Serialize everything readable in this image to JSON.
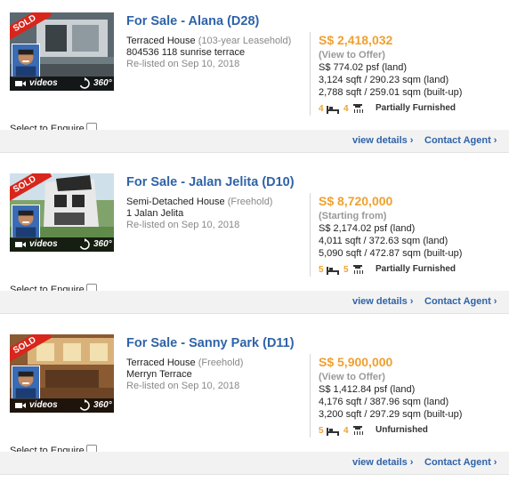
{
  "common": {
    "select_to_enquire": "Select to Enquire",
    "view_details": "view details ›",
    "contact_agent": "Contact Agent ›",
    "videos": "videos",
    "deg360": "360°",
    "sold": "SOLD"
  },
  "listings": [
    {
      "title": "For Sale - Alana (D28)",
      "type": "Terraced House",
      "tenure": "(103-year Leasehold)",
      "address": "804536 118 sunrise terrace",
      "relisted": "Re-listed on Sep 10, 2018",
      "price": "S$ 2,418,032",
      "price_note": "(View to Offer)",
      "psf": "S$ 774.02 psf (land)",
      "land": "3,124 sqft / 290.23 sqm (land)",
      "builtup": "2,788 sqft / 259.01 sqm (built-up)",
      "bedrooms": "4",
      "bathrooms": "4",
      "furnishing": "Partially Furnished",
      "photo_colors": [
        "#5b6870",
        "#c9cfd2",
        "#3b4246"
      ]
    },
    {
      "title": "For Sale - Jalan Jelita (D10)",
      "type": "Semi-Detached House",
      "tenure": "(Freehold)",
      "address": "1 Jalan Jelita",
      "relisted": "Re-listed on Sep 10, 2018",
      "price": "S$ 8,720,000",
      "price_note": "(Starting from)",
      "psf": "S$ 2,174.02 psf (land)",
      "land": "4,011 sqft / 372.63 sqm (land)",
      "builtup": "5,090 sqft / 472.87 sqm (built-up)",
      "bedrooms": "5",
      "bathrooms": "5",
      "furnishing": "Partially Furnished",
      "photo_colors": [
        "#7fa36a",
        "#e8e8e8",
        "#2a2a2a"
      ]
    },
    {
      "title": "For Sale - Sanny Park (D11)",
      "type": "Terraced House",
      "tenure": "(Freehold)",
      "address": "Merryn Terrace",
      "relisted": "Re-listed on Sep 10, 2018",
      "price": "S$ 5,900,000",
      "price_note": "(View to Offer)",
      "psf": "S$ 1,412.84 psf (land)",
      "land": "4,176 sqft / 387.96 sqm (land)",
      "builtup": "3,200 sqft / 297.29 sqm (built-up)",
      "bedrooms": "5",
      "bathrooms": "4",
      "furnishing": "Unfurnished",
      "photo_colors": [
        "#8a5a33",
        "#d9b27a",
        "#5a3820"
      ]
    }
  ]
}
